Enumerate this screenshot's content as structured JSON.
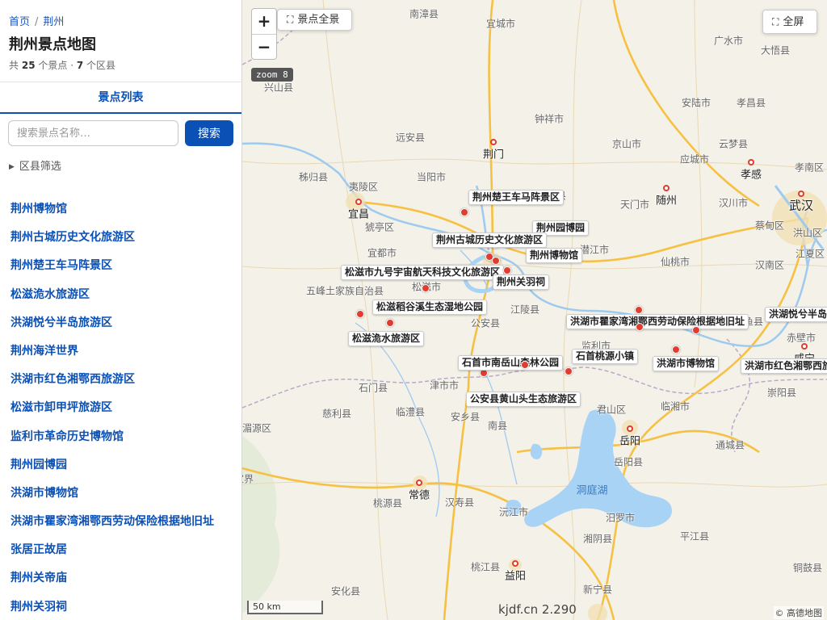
{
  "breadcrumb": {
    "home": "首页",
    "separator": "/",
    "current": "荆州"
  },
  "page_title": "荆州景点地图",
  "stats": {
    "prefix": "共",
    "spot_count": "25",
    "spot_unit": "个景点 ·",
    "district_count": "7",
    "district_unit": "个区县"
  },
  "tab": {
    "label": "景点列表"
  },
  "search": {
    "placeholder": "搜索景点名称…",
    "button": "搜索"
  },
  "filter": {
    "label": "区县筛选"
  },
  "spots": [
    "荆州博物馆",
    "荆州古城历史文化旅游区",
    "荆州楚王车马阵景区",
    "松滋洈水旅游区",
    "洪湖悦兮半岛旅游区",
    "荆州海洋世界",
    "洪湖市红色湘鄂西旅游区",
    "松滋市卸甲坪旅游区",
    "监利市革命历史博物馆",
    "荆州园博园",
    "洪湖市博物馆",
    "洪湖市瞿家湾湘鄂西劳动保险根据地旧址",
    "张居正故居",
    "荆州关帝庙",
    "荆州关羽祠"
  ],
  "map_controls": {
    "zoom_in": "+",
    "zoom_out": "−",
    "overview": "景点全景",
    "fullscreen": "全屏",
    "zoom_level": "zoom 8"
  },
  "scale_label": "50 km",
  "version_text": "kjdf.cn 2.290",
  "attribution": "© 高德地图",
  "colors": {
    "accent": "#0b50b4",
    "marker": "#e03c31",
    "water": "#a9d3f5",
    "highway": "#f6c143"
  },
  "map_labels": {
    "cities": [
      "宜昌",
      "荆门",
      "武汉",
      "随州",
      "孝感",
      "岳阳",
      "常德",
      "益阳",
      "咸宁"
    ],
    "places": [
      "南漳县",
      "宜城市",
      "广水市",
      "大悟县",
      "兴山县",
      "钟祥市",
      "安陆市",
      "孝昌县",
      "远安县",
      "京山市",
      "云梦县",
      "秭归县",
      "当阳市",
      "应城市",
      "孝南区",
      "夷陵区",
      "沙洋县",
      "汉川市",
      "天门市",
      "蔡甸区",
      "洪山区",
      "猇亭区",
      "宜都市",
      "潜江市",
      "汉南区",
      "江夏区",
      "仙桃市",
      "五峰土家族自治县",
      "松滋市",
      "江陵县",
      "嘉鱼县",
      "监利市",
      "公安县",
      "石首市",
      "石门县",
      "津市市",
      "赤壁市",
      "崇阳县",
      "慈利县",
      "临澧县",
      "安乡县",
      "南县",
      "君山区",
      "临湘市",
      "通城县",
      "岳阳县",
      "桃源县",
      "汉寿县",
      "沅江市",
      "汨罗市",
      "平江县",
      "湘阴县",
      "桃江县",
      "安化县",
      "张家界",
      "湄源区",
      "铜鼓县",
      "新宁县"
    ],
    "water": "洞庭湖"
  },
  "markers": [
    "荆州楚王车马阵景区",
    "荆州园博园",
    "荆州古城历史文化旅游区",
    "荆州博物馆",
    "松滋市九号宇宙航天科技文化旅游区",
    "荆州关羽祠",
    "松滋稻谷溪生态湿地公园",
    "洪湖市瞿家湾湘鄂西劳动保险根据地旧址",
    "洪湖悦兮半岛旅游区",
    "松滋洈水旅游区",
    "石首市南岳山森林公园",
    "石首桃源小镇",
    "洪湖市博物馆",
    "洪湖市红色湘鄂西旅游区",
    "公安县黄山头生态旅游区"
  ]
}
